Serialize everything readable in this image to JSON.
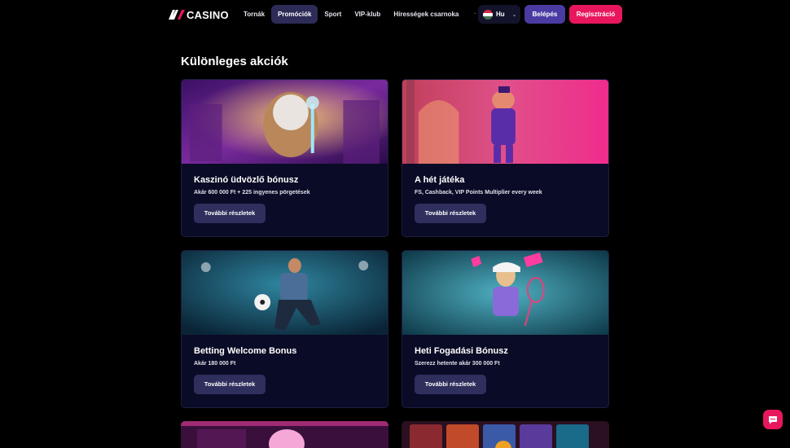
{
  "header": {
    "logo_text": "CASINO",
    "nav": [
      {
        "label": "Tornák",
        "active": false
      },
      {
        "label": "Promóciók",
        "active": true
      },
      {
        "label": "Sport",
        "active": false
      },
      {
        "label": "VIP-klub",
        "active": false
      },
      {
        "label": "Hírességek csarnoka",
        "active": false
      }
    ],
    "more_label": "···",
    "language": {
      "label": "Hu",
      "flag_icon": "hungary-flag-icon"
    },
    "login_label": "Belépés",
    "register_label": "Regisztráció"
  },
  "main": {
    "title": "Különleges akciók",
    "promos": [
      {
        "title": "Kaszinó üdvözlő bónusz",
        "subtitle": "Akár 600 000 Ft + 225 ingyenes pörgetések",
        "button": "További részletek"
      },
      {
        "title": "A hét játéka",
        "subtitle": "FS, Cashback, VIP Points Multiplier every week",
        "button": "További részletek"
      },
      {
        "title": "Betting Welcome Bonus",
        "subtitle": "Akár 180 000 Ft",
        "button": "További részletek"
      },
      {
        "title": "Heti Fogadási Bónusz",
        "subtitle": "Szerezz hetente akár 300 000 Ft",
        "button": "További részletek"
      }
    ]
  },
  "colors": {
    "background": "#000000",
    "card": "#0a0b26",
    "accent_pink": "#e8175d",
    "accent_purple": "#4a3ba3",
    "button": "#2f2f5e"
  },
  "chat": {
    "icon": "chat-icon"
  }
}
